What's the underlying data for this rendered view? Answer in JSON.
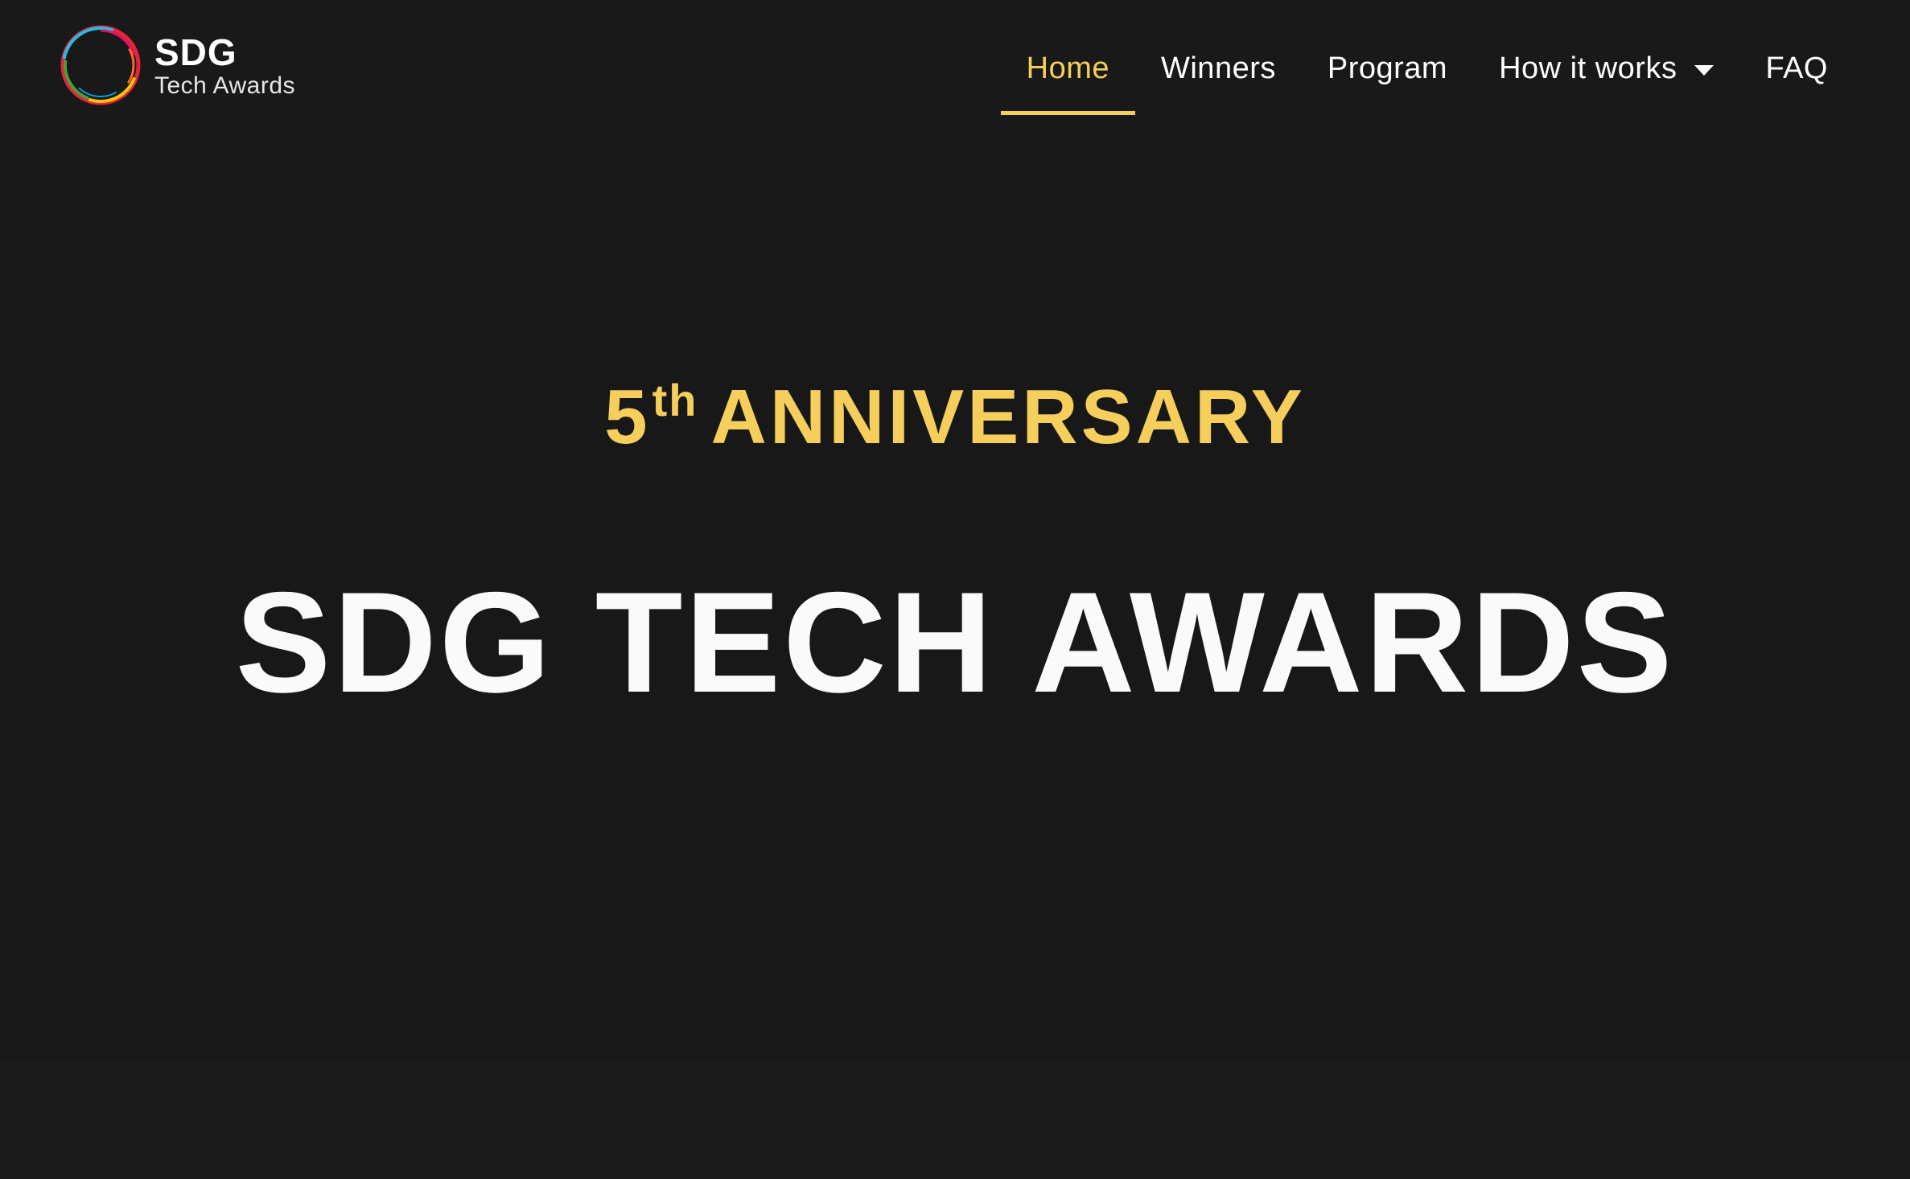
{
  "brand": {
    "title": "SDG",
    "subtitle": "Tech Awards",
    "logo_icon": "sdg-color-ring-icon",
    "ring_colors": [
      "#e5243b",
      "#fcc30b",
      "#4c9f38",
      "#26bde2",
      "#0a97d9",
      "#dd1367",
      "#fd6925"
    ]
  },
  "nav": {
    "items": [
      {
        "label": "Home",
        "active": true
      },
      {
        "label": "Winners",
        "active": false
      },
      {
        "label": "Program",
        "active": false
      },
      {
        "label": "How it works",
        "active": false,
        "dropdown": true
      },
      {
        "label": "FAQ",
        "active": false
      }
    ]
  },
  "hero": {
    "eyebrow_number": "5",
    "eyebrow_suffix": "th",
    "eyebrow_text": "ANNIVERSARY",
    "title": "SDG TECH AWARDS"
  },
  "colors": {
    "accent": "#f5ce5b",
    "background": "#191919",
    "text": "#ffffff"
  }
}
